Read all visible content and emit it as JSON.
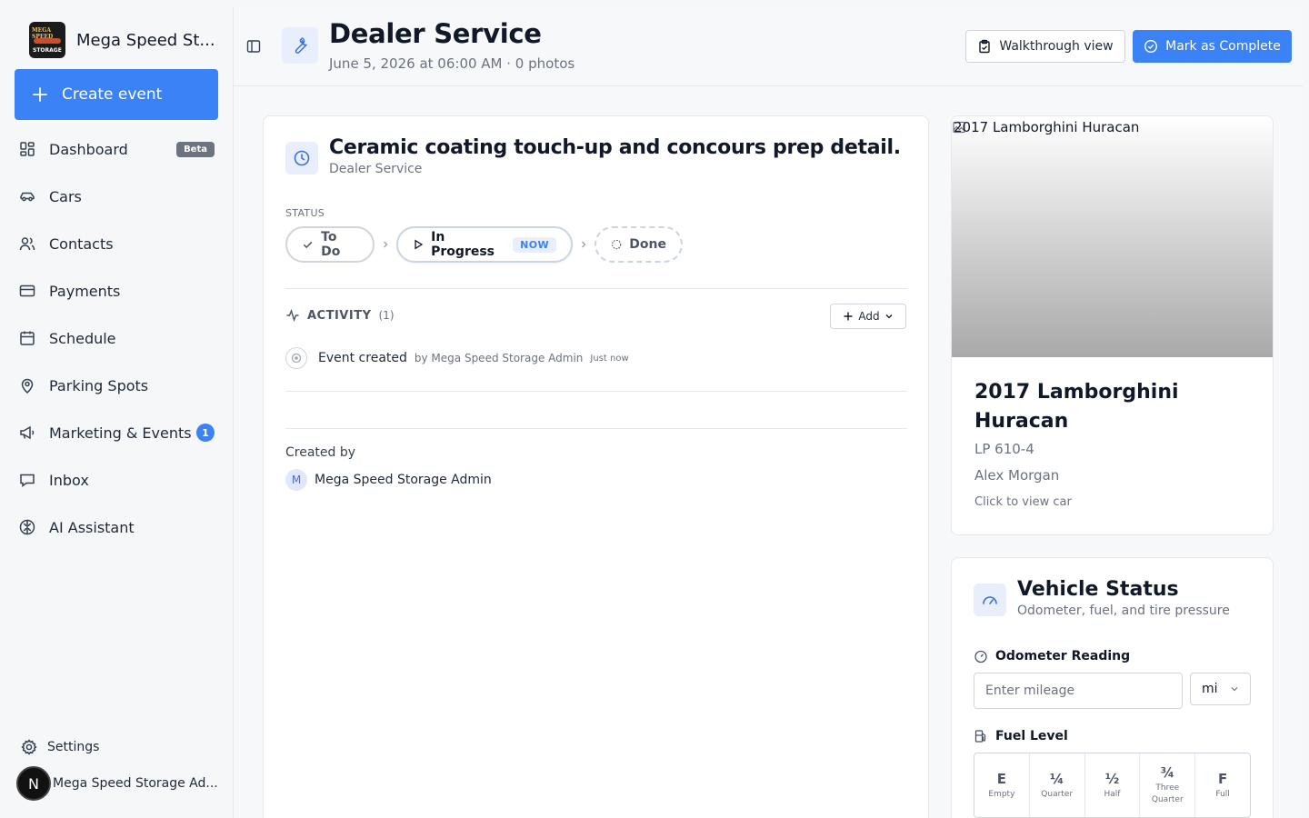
{
  "sidebar": {
    "brand_name": "Mega Speed St...",
    "logo_text_top": "MEGA SPEED",
    "logo_text_bottom": "STORAGE",
    "create_label": "Create event",
    "items": [
      {
        "label": "Dashboard",
        "icon": "dashboard-icon",
        "badge": "Beta"
      },
      {
        "label": "Cars",
        "icon": "car-icon"
      },
      {
        "label": "Contacts",
        "icon": "users-icon"
      },
      {
        "label": "Payments",
        "icon": "credit-card-icon"
      },
      {
        "label": "Schedule",
        "icon": "calendar-icon"
      },
      {
        "label": "Parking Spots",
        "icon": "map-pin-icon"
      },
      {
        "label": "Marketing & Events",
        "icon": "megaphone-icon",
        "count": "1"
      },
      {
        "label": "Inbox",
        "icon": "inbox-icon"
      },
      {
        "label": "AI Assistant",
        "icon": "brain-icon"
      }
    ],
    "settings_label": "Settings",
    "user_initial": "N",
    "user_name": "Mega Speed Storage Ad..."
  },
  "header": {
    "title": "Dealer Service",
    "subtitle": "June 5, 2026 at 06:00 AM · 0 photos",
    "walkthrough_label": "Walkthrough view",
    "complete_label": "Mark as Complete"
  },
  "event": {
    "title": "Ceramic coating touch-up and concours prep detail.",
    "type": "Dealer Service",
    "status_label": "STATUS",
    "statuses": {
      "todo": "To Do",
      "in_progress": "In Progress",
      "now_tag": "NOW",
      "done": "Done"
    },
    "current_status": "In Progress",
    "activity": {
      "title": "ACTIVITY",
      "count": "(1)",
      "add_label": "Add",
      "items": [
        {
          "text": "Event created",
          "by": "by Mega Speed Storage Admin",
          "time": "Just now"
        }
      ]
    },
    "created_by_label": "Created by",
    "created_by_initial": "M",
    "created_by_name": "Mega Speed Storage Admin"
  },
  "car": {
    "image_alt": "2017 Lamborghini Huracan",
    "name": "2017 Lamborghini Huracan",
    "trim": "LP 610-4",
    "owner": "Alex Morgan",
    "link_text": "Click to view car"
  },
  "vehicle_status": {
    "title": "Vehicle Status",
    "subtitle": "Odometer, fuel, and tire pressure",
    "odometer_label": "Odometer Reading",
    "odometer_placeholder": "Enter mileage",
    "odometer_value": "",
    "unit": "mi",
    "fuel_label": "Fuel Level",
    "fuel_options": [
      {
        "symbol": "E",
        "name": "Empty"
      },
      {
        "symbol": "¼",
        "name": "Quarter"
      },
      {
        "symbol": "½",
        "name": "Half"
      },
      {
        "symbol": "¾",
        "name": "Three Quarter"
      },
      {
        "symbol": "F",
        "name": "Full"
      }
    ]
  },
  "colors": {
    "accent": "#3b82f6",
    "icon_bg": "#e8eefb",
    "sidebar_bg": "#f6f7f9",
    "badge_beta": "#6b7280"
  }
}
